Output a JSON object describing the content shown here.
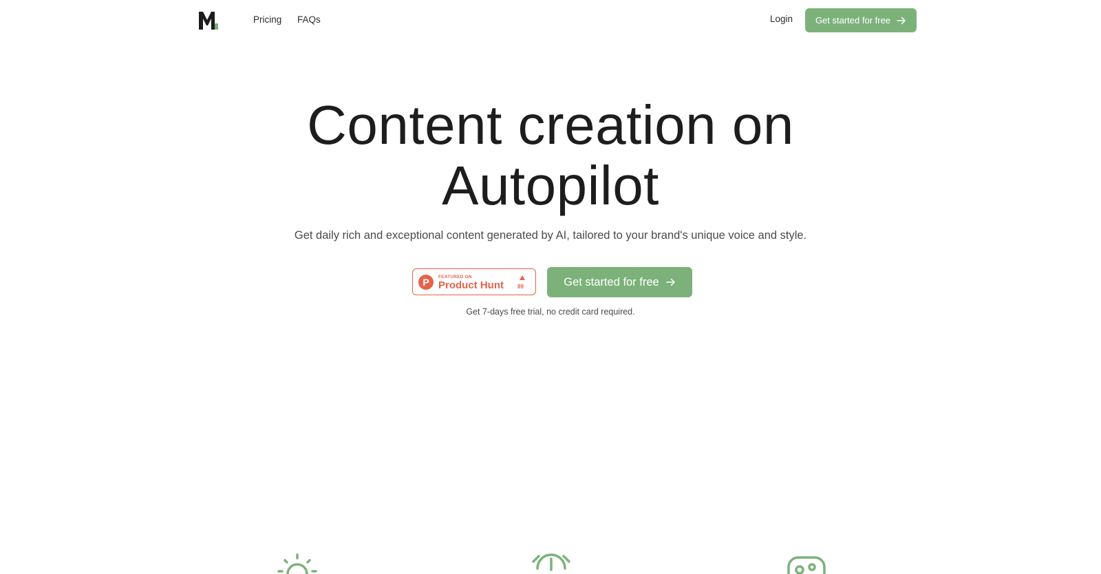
{
  "nav": {
    "links": [
      "Pricing",
      "FAQs"
    ],
    "login": "Login",
    "cta": "Get started for free"
  },
  "hero": {
    "title_line1": "Content creation on",
    "title_line2": "Autopilot",
    "subtitle": "Get daily rich and exceptional content generated by AI, tailored to your brand's unique voice and style.",
    "cta": "Get started for free",
    "trial_note": "Get 7-days free trial, no credit card required."
  },
  "product_hunt": {
    "featured": "FEATURED ON",
    "name": "Product Hunt",
    "letter": "P",
    "upvotes": "89"
  },
  "colors": {
    "accent": "#7cb27a",
    "product_hunt": "#e4634a",
    "logo": "#1d1d1d"
  },
  "icons": [
    "sun-icon",
    "alarm-clock-icon",
    "gamepad-icon"
  ]
}
